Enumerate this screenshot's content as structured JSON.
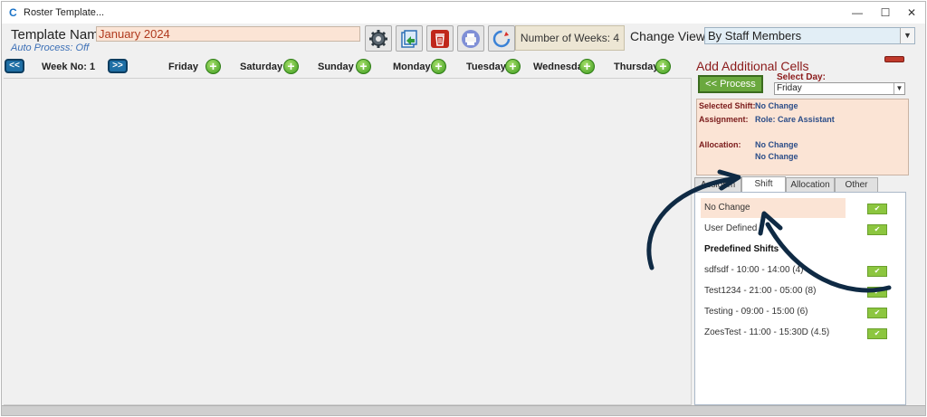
{
  "window": {
    "title": "Roster Template...",
    "app_icon": "C",
    "minimize": "—",
    "maximize": "☐",
    "close": "✕"
  },
  "header": {
    "template_label": "Template Name:",
    "template_value": "January 2024",
    "auto_process": "Auto Process: Off",
    "toolbar_icons": [
      "gear-icon",
      "export-icon",
      "delete-icon",
      "print-icon",
      "refresh-icon"
    ],
    "weeks_text": "Number of Weeks: 4",
    "change_view_label": "Change View:",
    "change_view_value": "By Staff Members"
  },
  "grid": {
    "prev_label": "<<",
    "next_label": ">>",
    "week_label": "Week No: 1",
    "days": [
      "Friday",
      "Saturday",
      "Sunday",
      "Monday",
      "Tuesday",
      "Wednesda",
      "Thursday"
    ]
  },
  "panel": {
    "title": "Add Additional Cells",
    "process_label": "<< Process",
    "select_day_label": "Select Day:",
    "select_day_value": "Friday",
    "info": {
      "selected_shift_label": "Selected Shift:",
      "selected_shift_value": "No Change",
      "assignment_label": "Assignment:",
      "assignment_value": "Role: Care Assistant",
      "allocation_label": "Allocation:",
      "allocation_value_1": "No Change",
      "allocation_value_2": "No Change"
    },
    "tabs": [
      "Assignm",
      "Shift",
      "Allocation",
      "Other"
    ],
    "active_tab": "Shift",
    "shift_options": [
      "No Change",
      "User Defined"
    ],
    "predefined_header": "Predefined Shifts",
    "predefined_shifts": [
      "sdfsdf - 10:00 - 14:00 (4)",
      "Test1234 - 21:00 - 05:00 (8)",
      "Testing - 09:00 - 15:00 (6)",
      "ZoesTest - 11:00 - 15:30D (4.5)"
    ],
    "check_glyph": "✔"
  },
  "colors": {
    "accent_red": "#8b1a1a",
    "highlight_peach": "#fbe4d5",
    "nav_blue": "#1f6fa5",
    "check_green": "#8cc63f",
    "arrow_navy": "#0f2a44"
  }
}
